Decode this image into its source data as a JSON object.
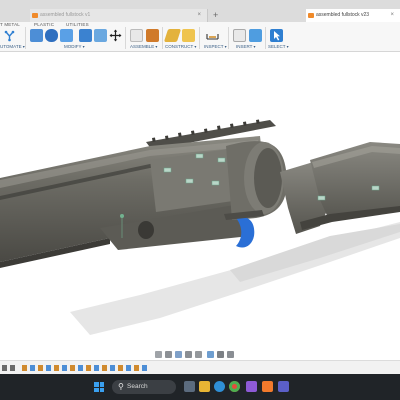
{
  "tabs": {
    "inactive_label": "assembled fullstock v1",
    "active_label": "assembled fullstock v23",
    "close_glyph": "×",
    "new_tab_glyph": "+"
  },
  "ribbon": {
    "tabs": [
      "T METAL",
      "PLASTIC",
      "UTILITIES"
    ],
    "groups": {
      "automate": "UTOMATE",
      "modify": "MODIFY",
      "assemble": "ASSEMBLE",
      "construct": "CONSTRUCT",
      "inspect": "INSPECT",
      "insert": "INSERT",
      "select": "SELECT"
    },
    "accent": "#2f7fd1"
  },
  "viewport": {
    "background": "#ffffff",
    "model_color": "#6f6e67",
    "trigger_color": "#2a6fd6"
  },
  "taskbar": {
    "search_placeholder": "Search",
    "icons": [
      "task-view",
      "file-explorer",
      "edge",
      "chrome",
      "copilot",
      "fusion360",
      "teams"
    ]
  }
}
